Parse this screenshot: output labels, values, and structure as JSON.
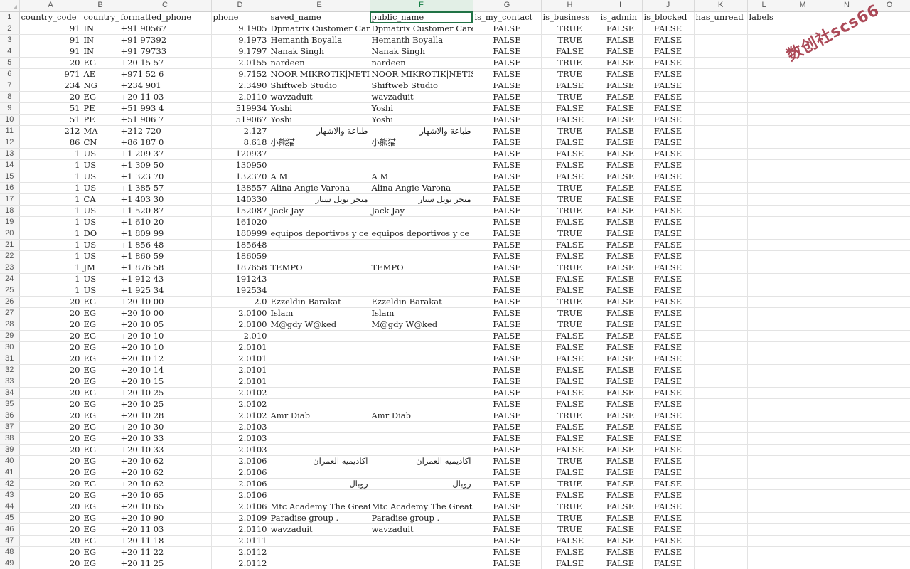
{
  "columns": [
    "A",
    "B",
    "C",
    "D",
    "E",
    "F",
    "G",
    "H",
    "I",
    "J",
    "K",
    "L",
    "M",
    "N",
    "O"
  ],
  "selected_column": "F",
  "headers": [
    "country_code",
    "country_",
    "formatted_phone",
    "phone",
    "saved_name",
    "public_name",
    "is_my_contact",
    "is_business",
    "is_admin",
    "is_blocked",
    "has_unread",
    "labels"
  ],
  "rows": [
    [
      "91",
      "IN",
      "+91 90567",
      "9.1905",
      "Dpmatrix Customer Care",
      "Dpmatrix Customer Care",
      "FALSE",
      "TRUE",
      "FALSE",
      "FALSE"
    ],
    [
      "91",
      "IN",
      "+91 97392",
      "9.1973",
      "Hemanth Boyalla",
      "Hemanth Boyalla",
      "FALSE",
      "TRUE",
      "FALSE",
      "FALSE"
    ],
    [
      "91",
      "IN",
      "+91 79733",
      "9.1797",
      "Nanak Singh",
      "Nanak Singh",
      "FALSE",
      "FALSE",
      "FALSE",
      "FALSE"
    ],
    [
      "20",
      "EG",
      "+20 15 57",
      "2.0155",
      "nardeen",
      "nardeen",
      "FALSE",
      "TRUE",
      "FALSE",
      "FALSE"
    ],
    [
      "971",
      "AE",
      "+971 52 6",
      "9.7152",
      "NOOR MIKROTIK|NETIS|HA",
      "NOOR MIKROTIK|NETIS|HAV",
      "FALSE",
      "TRUE",
      "FALSE",
      "FALSE"
    ],
    [
      "234",
      "NG",
      "+234 901",
      "2.3490",
      "Shiftweb Studio",
      "Shiftweb Studio",
      "FALSE",
      "FALSE",
      "FALSE",
      "FALSE"
    ],
    [
      "20",
      "EG",
      "+20 11 03",
      "2.0110",
      "wavzaduit",
      "wavzaduit",
      "FALSE",
      "TRUE",
      "FALSE",
      "FALSE"
    ],
    [
      "51",
      "PE",
      "+51 993 4",
      "519934",
      "Yoshi",
      "Yoshi",
      "FALSE",
      "FALSE",
      "FALSE",
      "FALSE"
    ],
    [
      "51",
      "PE",
      "+51 906 7",
      "519067",
      "Yoshi",
      "Yoshi",
      "FALSE",
      "FALSE",
      "FALSE",
      "FALSE"
    ],
    [
      "212",
      "MA",
      "+212 720",
      "2.127",
      "طباعة والاشهار",
      "طباعة والاشهار",
      "FALSE",
      "TRUE",
      "FALSE",
      "FALSE"
    ],
    [
      "86",
      "CN",
      "+86 187 0",
      "8.618",
      "小熊猫",
      "小熊猫",
      "FALSE",
      "FALSE",
      "FALSE",
      "FALSE"
    ],
    [
      "1",
      "US",
      "+1 209 37",
      "120937",
      "",
      "",
      "FALSE",
      "FALSE",
      "FALSE",
      "FALSE"
    ],
    [
      "1",
      "US",
      "+1 309 50",
      "130950",
      "",
      "",
      "FALSE",
      "FALSE",
      "FALSE",
      "FALSE"
    ],
    [
      "1",
      "US",
      "+1 323 70",
      "132370",
      "A M",
      "A M",
      "FALSE",
      "FALSE",
      "FALSE",
      "FALSE"
    ],
    [
      "1",
      "US",
      "+1 385 57",
      "138557",
      "Alina Angie Varona",
      "Alina Angie Varona",
      "FALSE",
      "TRUE",
      "FALSE",
      "FALSE"
    ],
    [
      "1",
      "CA",
      "+1 403 30",
      "140330",
      "متجر نوبل ستار",
      "متجر نوبل ستار",
      "FALSE",
      "TRUE",
      "FALSE",
      "FALSE"
    ],
    [
      "1",
      "US",
      "+1 520 87",
      "152087",
      "Jack Jay",
      "Jack Jay",
      "FALSE",
      "TRUE",
      "FALSE",
      "FALSE"
    ],
    [
      "1",
      "US",
      "+1 610 20",
      "161020",
      "",
      "",
      "FALSE",
      "FALSE",
      "FALSE",
      "FALSE"
    ],
    [
      "1",
      "DO",
      "+1 809 99",
      "180999",
      "equipos deportivos y ce",
      "equipos deportivos y ce",
      "FALSE",
      "TRUE",
      "FALSE",
      "FALSE"
    ],
    [
      "1",
      "US",
      "+1 856 48",
      "185648",
      "",
      "",
      "FALSE",
      "FALSE",
      "FALSE",
      "FALSE"
    ],
    [
      "1",
      "US",
      "+1 860 59",
      "186059",
      "",
      "",
      "FALSE",
      "FALSE",
      "FALSE",
      "FALSE"
    ],
    [
      "1",
      "JM",
      "+1 876 58",
      "187658",
      "TEMPO",
      "TEMPO",
      "FALSE",
      "TRUE",
      "FALSE",
      "FALSE"
    ],
    [
      "1",
      "US",
      "+1 912 43",
      "191243",
      "",
      "",
      "FALSE",
      "FALSE",
      "FALSE",
      "FALSE"
    ],
    [
      "1",
      "US",
      "+1 925 34",
      "192534",
      "",
      "",
      "FALSE",
      "FALSE",
      "FALSE",
      "FALSE"
    ],
    [
      "20",
      "EG",
      "+20 10 00",
      "2.0",
      "Ezzeldin Barakat",
      "Ezzeldin Barakat",
      "FALSE",
      "TRUE",
      "FALSE",
      "FALSE"
    ],
    [
      "20",
      "EG",
      "+20 10 00",
      "2.0100",
      "Islam",
      "Islam",
      "FALSE",
      "TRUE",
      "FALSE",
      "FALSE"
    ],
    [
      "20",
      "EG",
      "+20 10 05",
      "2.0100",
      "M@gdy W@ked",
      "M@gdy W@ked",
      "FALSE",
      "TRUE",
      "FALSE",
      "FALSE"
    ],
    [
      "20",
      "EG",
      "+20 10 10",
      "2.010",
      "",
      "",
      "FALSE",
      "FALSE",
      "FALSE",
      "FALSE"
    ],
    [
      "20",
      "EG",
      "+20 10 10",
      "2.0101",
      "",
      "",
      "FALSE",
      "FALSE",
      "FALSE",
      "FALSE"
    ],
    [
      "20",
      "EG",
      "+20 10 12",
      "2.0101",
      "",
      "",
      "FALSE",
      "FALSE",
      "FALSE",
      "FALSE"
    ],
    [
      "20",
      "EG",
      "+20 10 14",
      "2.0101",
      "",
      "",
      "FALSE",
      "FALSE",
      "FALSE",
      "FALSE"
    ],
    [
      "20",
      "EG",
      "+20 10 15",
      "2.0101",
      "",
      "",
      "FALSE",
      "FALSE",
      "FALSE",
      "FALSE"
    ],
    [
      "20",
      "EG",
      "+20 10 25",
      "2.0102",
      "",
      "",
      "FALSE",
      "FALSE",
      "FALSE",
      "FALSE"
    ],
    [
      "20",
      "EG",
      "+20 10 25",
      "2.0102",
      "",
      "",
      "FALSE",
      "FALSE",
      "FALSE",
      "FALSE"
    ],
    [
      "20",
      "EG",
      "+20 10 28",
      "2.0102",
      "Amr Diab",
      "Amr Diab",
      "FALSE",
      "TRUE",
      "FALSE",
      "FALSE"
    ],
    [
      "20",
      "EG",
      "+20 10 30",
      "2.0103",
      "",
      "",
      "FALSE",
      "FALSE",
      "FALSE",
      "FALSE"
    ],
    [
      "20",
      "EG",
      "+20 10 33",
      "2.0103",
      "",
      "",
      "FALSE",
      "FALSE",
      "FALSE",
      "FALSE"
    ],
    [
      "20",
      "EG",
      "+20 10 33",
      "2.0103",
      "",
      "",
      "FALSE",
      "FALSE",
      "FALSE",
      "FALSE"
    ],
    [
      "20",
      "EG",
      "+20 10 62",
      "2.0106",
      "اكاديميه العمران",
      "اكاديميه العمران",
      "FALSE",
      "TRUE",
      "FALSE",
      "FALSE"
    ],
    [
      "20",
      "EG",
      "+20 10 62",
      "2.0106",
      "",
      "",
      "FALSE",
      "FALSE",
      "FALSE",
      "FALSE"
    ],
    [
      "20",
      "EG",
      "+20 10 62",
      "2.0106",
      "روبال",
      "روبال",
      "FALSE",
      "TRUE",
      "FALSE",
      "FALSE"
    ],
    [
      "20",
      "EG",
      "+20 10 65",
      "2.0106",
      "",
      "",
      "FALSE",
      "FALSE",
      "FALSE",
      "FALSE"
    ],
    [
      "20",
      "EG",
      "+20 10 65",
      "2.0106",
      "Mtc Academy The Great",
      "Mtc Academy The Great C",
      "FALSE",
      "TRUE",
      "FALSE",
      "FALSE"
    ],
    [
      "20",
      "EG",
      "+20 10 90",
      "2.0109",
      "Paradise group .",
      "Paradise group .",
      "FALSE",
      "TRUE",
      "FALSE",
      "FALSE"
    ],
    [
      "20",
      "EG",
      "+20 11 03",
      "2.0110",
      "wavzaduit",
      "wavzaduit",
      "FALSE",
      "TRUE",
      "FALSE",
      "FALSE"
    ],
    [
      "20",
      "EG",
      "+20 11 18",
      "2.0111",
      "",
      "",
      "FALSE",
      "FALSE",
      "FALSE",
      "FALSE"
    ],
    [
      "20",
      "EG",
      "+20 11 22",
      "2.0112",
      "",
      "",
      "FALSE",
      "FALSE",
      "FALSE",
      "FALSE"
    ],
    [
      "20",
      "EG",
      "+20 11 25",
      "2.0112",
      "",
      "",
      "FALSE",
      "FALSE",
      "FALSE",
      "FALSE"
    ]
  ],
  "watermark": "数创社scs66"
}
